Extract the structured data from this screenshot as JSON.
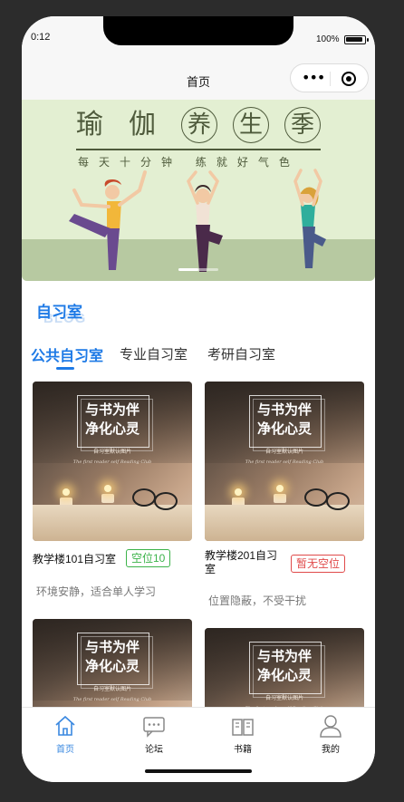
{
  "status": {
    "time": "0:12",
    "battery": "100%"
  },
  "nav": {
    "title": "首页"
  },
  "banner": {
    "title_chars": [
      "瑜",
      "伽"
    ],
    "circle_chars": [
      "养",
      "生",
      "季"
    ],
    "subtitle": "每天十分钟 练就好气色"
  },
  "section": {
    "title": "自习室",
    "watermark": "BLOG"
  },
  "tabs": [
    {
      "label": "公共自习室",
      "active": true
    },
    {
      "label": "专业自习室",
      "active": false
    },
    {
      "label": "考研自习室",
      "active": false
    }
  ],
  "card_image": {
    "line1": "与书为伴",
    "line2": "净化心灵",
    "caption": "自习室默认图片",
    "script": "The first reader self Reading Club"
  },
  "rooms": [
    {
      "name": "教学楼101自习室",
      "badge": "空位10",
      "badge_color": "#3cb34a",
      "desc": "环境安静，适合单人学习"
    },
    {
      "name": "教学楼201自习室",
      "badge": "暂无空位",
      "badge_color": "#e04a4a",
      "desc": "位置隐蔽，不受干扰"
    }
  ],
  "tabbar": [
    {
      "label": "首页",
      "icon": "home-icon",
      "active": true
    },
    {
      "label": "论坛",
      "icon": "forum-icon",
      "active": false
    },
    {
      "label": "书籍",
      "icon": "book-icon",
      "active": false
    },
    {
      "label": "我的",
      "icon": "user-icon",
      "active": false
    }
  ],
  "colors": {
    "accent": "#1e7ae6",
    "available": "#3cb34a",
    "full": "#e04a4a"
  }
}
